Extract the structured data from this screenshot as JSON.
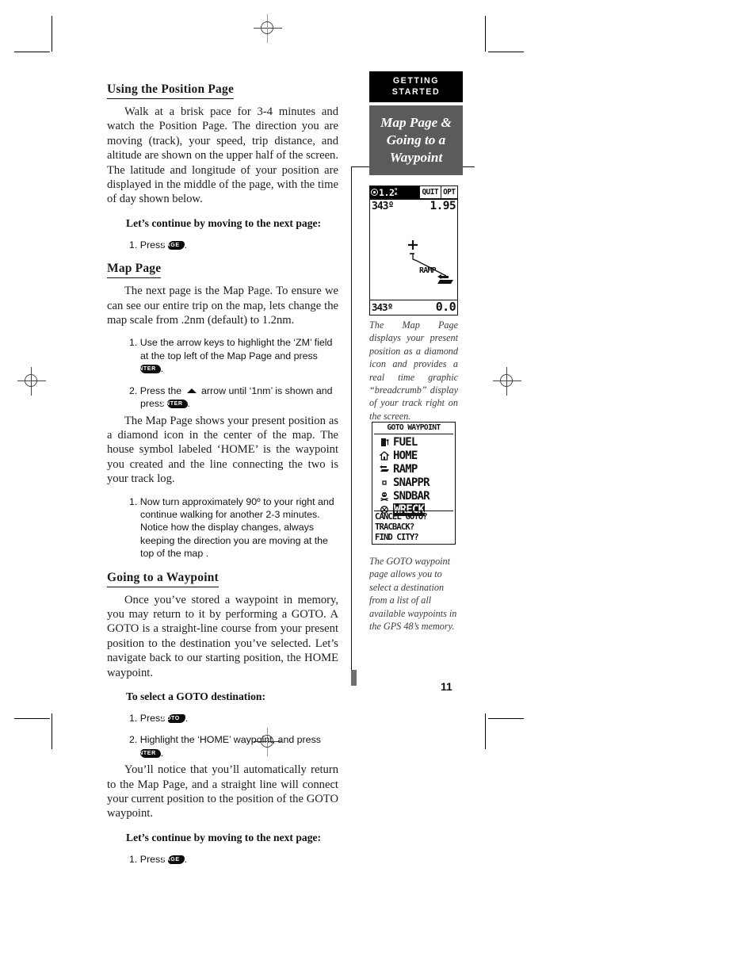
{
  "page": {
    "number": "11"
  },
  "sidebar": {
    "chapter_label_line1": "GETTING",
    "chapter_label_line2": "STARTED",
    "topic_line1": "Map Page &",
    "topic_line2": "Going to a",
    "topic_line3": "Waypoint"
  },
  "sections": {
    "position_page": {
      "heading": "Using the Position Page",
      "paragraph": "Walk at a brisk pace for 3-4 minutes and watch the Position Page.  The direction you are moving (track), your speed, trip distance, and altitude are shown on the upper half of the screen.  The latitude and longitude of your position are displayed in the middle of the page, with the time of day shown below.",
      "leadin": "Let’s continue by moving to the next page:",
      "step1_pre": "1. Press",
      "step1_key": "PAGE",
      "step1_post": "."
    },
    "map_page": {
      "heading": "Map Page",
      "paragraph": "The next page is the Map Page.  To ensure we can see our entire trip on the map, lets change the map scale from .2nm (default) to 1.2nm.",
      "step1_pre": "1. Use the arrow keys to highlight the ‘ZM’ field at the top left of the Map Page and press",
      "step1_key": "ENTER",
      "step1_post": ".",
      "step2_pre": "2. Press the",
      "step2_mid": "arrow until ‘1nm’ is shown and press",
      "step2_key": "ENTER",
      "step2_post": ".",
      "paragraph2": "The Map Page shows your present position as a diamond icon in the center of the map.  The house symbol labeled ‘HOME’ is the waypoint you created and the line connecting the two is your track log.",
      "step3": "1. Now turn approximately 90º to your right and continue walking for another 2-3 minutes.  Notice how the display changes, always keeping the direction you are moving at the top of the map ."
    },
    "going_to_waypoint": {
      "heading": "Going to a Waypoint",
      "paragraph": "Once you’ve stored a waypoint in memory, you may return to it by performing a GOTO.  A GOTO is a straight-line course from your present position to the destination you’ve selected.  Let’s navigate back to our starting position, the HOME waypoint.",
      "leadin": "To select a GOTO destination:",
      "step1_pre": "1. Press",
      "step1_key": "GOTO",
      "step1_post": ".",
      "step2_pre": "2. Highlight the ‘HOME’ waypoint, and press",
      "step2_key": "ENTER",
      "step2_post": ".",
      "paragraph2": "You’ll notice that you’ll automatically return to the Map Page, and a straight line will connect your current position to the position of the GOTO waypoint.",
      "leadin2": "Let’s continue by moving to the next page:",
      "step3_pre": "1. Press",
      "step3_key": "PAGE",
      "step3_post": "."
    }
  },
  "map_screen": {
    "zoom_value": "1.2",
    "zoom_unit_top": "n",
    "zoom_unit_bottom": "m",
    "softkey_quit": "QUIT",
    "softkey_opt": "OPT",
    "top_bearing": "343º",
    "top_value": "1.95",
    "bottom_bearing": "343º",
    "bottom_value": "0.0",
    "waypoint_label": "RAMP"
  },
  "goto_screen": {
    "title": "GOTO WAYPOINT",
    "waypoints": [
      {
        "name": "FUEL",
        "icon": "fuel-pump-icon",
        "selected": false
      },
      {
        "name": "HOME",
        "icon": "house-icon",
        "selected": false
      },
      {
        "name": "RAMP",
        "icon": "boat-ramp-icon",
        "selected": false
      },
      {
        "name": "SNAPPR",
        "icon": "small-dot-icon",
        "selected": false
      },
      {
        "name": "SNDBAR",
        "icon": "skull-icon",
        "selected": false
      },
      {
        "name": "WRECK",
        "icon": "wreck-icon",
        "selected": true
      }
    ],
    "options": [
      "CANCEL GOTO?",
      "TRACBACK?",
      "FIND CITY?"
    ]
  },
  "captions": {
    "map": "The Map Page displays your present position as a diamond icon and provides a real  time graphic “breadcrumb” display of your track right on the screen.",
    "goto": "The GOTO waypoint page allows you to select a destination from a list of all available waypoints in the GPS 48’s memory."
  }
}
